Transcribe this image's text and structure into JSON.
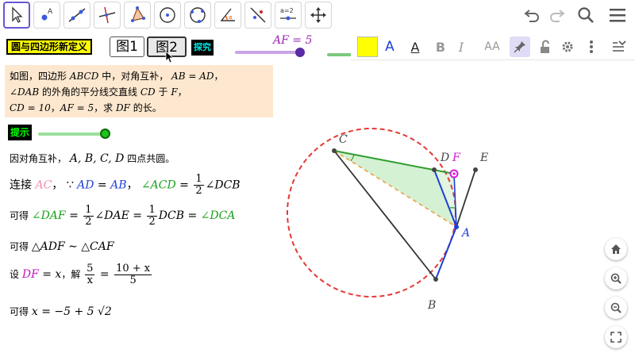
{
  "toolbar": {
    "tools": [
      {
        "name": "move-tool",
        "active": true
      },
      {
        "name": "point-tool"
      },
      {
        "name": "line-tool"
      },
      {
        "name": "perpendicular-line-tool"
      },
      {
        "name": "polygon-tool"
      },
      {
        "name": "circle-center-point-tool"
      },
      {
        "name": "circle-three-points-tool"
      },
      {
        "name": "angle-tool"
      },
      {
        "name": "reflect-tool"
      },
      {
        "name": "slider-tool",
        "text": "a=2"
      },
      {
        "name": "move-graphics-view-tool"
      }
    ],
    "right_icons": [
      "undo-icon",
      "redo-icon",
      "search-icon",
      "menu-icon"
    ]
  },
  "header": {
    "title": "圆与四边形新定义",
    "figure_buttons": [
      "图1",
      "图2"
    ],
    "explore_label": "探究",
    "af_label": "AF = 5"
  },
  "stylebar": {
    "color_swatch": "#ffff00",
    "text_color_label": "A",
    "bg_color_label": "A",
    "bold_label": "B",
    "italic_label": "I",
    "size_label": "AA"
  },
  "problem": {
    "intro": "如图，四边形",
    "quad": "ABCD",
    "mid": "中，对角互补，",
    "eq1": "AB = AD",
    "comma1": "，",
    "angle_label": "∠DAB",
    "line2": "的外角的平分线交直线",
    "cd": "CD",
    "at": "于",
    "f": "F",
    "comma2": "，",
    "eq2": "CD = 10",
    "comma3": "，",
    "eq3": "AF = 5",
    "ask": "，求",
    "df": "DF",
    "end": "的长。"
  },
  "hint": {
    "label": "提示",
    "step1_text": "因对角互补，",
    "step1_points": "A, B, C, D",
    "step1_end": "四点共圆。",
    "step2_prefix": "连接",
    "step2_ac": "AC",
    "step2_because": "，  ∵",
    "step2_ad": "AD",
    "step2_eq": " = ",
    "step2_ab": "AB",
    "step2_comma": "，",
    "step2_acd": "∠ACD",
    "step2_eq2": " = ",
    "step2_half": {
      "num": "1",
      "den": "2"
    },
    "step2_dcb": "∠DCB",
    "step3_prefix": "可得",
    "step3_daf": "∠DAF",
    "step3_eq": " = ",
    "step3_half1": {
      "num": "1",
      "den": "2"
    },
    "step3_dae": "∠DAE",
    "step3_eq2": " = ",
    "step3_half2": {
      "num": "1",
      "den": "2"
    },
    "step3_dcb": "DCB",
    "step3_eq3": " = ",
    "step3_dca": "∠DCA",
    "step4_prefix": "可得",
    "step4_sim": "△ADF ∼ △CAF",
    "step5_prefix": "设",
    "step5_df": "DF",
    "step5_eqx": " = x",
    "step5_solve": "，解",
    "step5_lhs": {
      "num": "5",
      "den": "x"
    },
    "step5_eq": " = ",
    "step5_rhs": {
      "num": "10 + x",
      "den": "5"
    },
    "step6_prefix": "可得",
    "step6_answer": "x = −5 + 5 √2"
  },
  "geometry": {
    "point_labels": {
      "C": "C",
      "D": "D",
      "F": "F",
      "E": "E",
      "A": "A",
      "B": "B"
    }
  },
  "nav": [
    "home-icon",
    "zoom-in-icon",
    "zoom-out-icon",
    "fullscreen-icon"
  ],
  "colors": {
    "accent": "#6557d2",
    "circle": "#e53935",
    "blue_segments": "#1f3fd6",
    "green_segment": "#2e9e2e",
    "triangle_fill": "#cdeecd",
    "orange_dashed": "#f0a040",
    "point_f": "#d81bd8",
    "problem_bg": "#fde8cf"
  }
}
